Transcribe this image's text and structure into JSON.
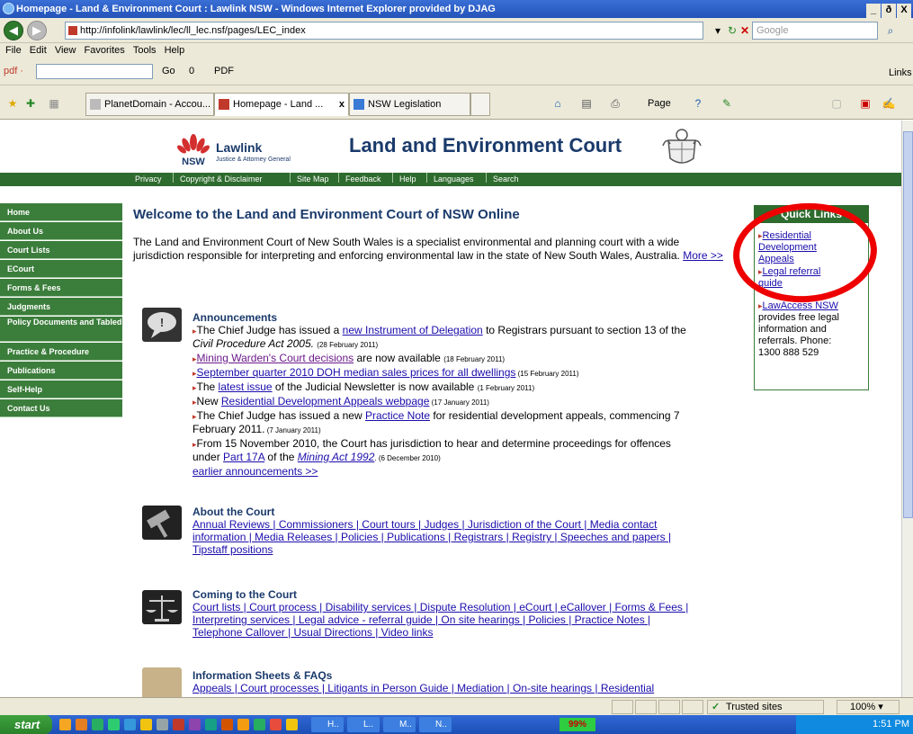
{
  "window": {
    "title": "Homepage - Land & Environment Court : Lawlink NSW - Windows Internet Explorer provided by DJAG",
    "btn_min": "_",
    "btn_max": "ð",
    "btn_close": "X"
  },
  "address": {
    "url": "http://infolink/lawlink/lec/ll_lec.nsf/pages/LEC_index",
    "search_placeholder": "Google"
  },
  "menu": [
    "File",
    "Edit",
    "View",
    "Favorites",
    "Tools",
    "Help"
  ],
  "linksbar": {
    "pdf_label": "pdf ·",
    "go_label": "Go",
    "zero_label": "0",
    "pdf_btn": "PDF",
    "links_label": "Links"
  },
  "tabs": [
    {
      "label": "PlanetDomain - Accou..."
    },
    {
      "label": "Homepage - Land ...",
      "close": "x"
    },
    {
      "label": "NSW Legislation"
    }
  ],
  "toolbar_right": {
    "page_label": "Page",
    "tools_label": "▾"
  },
  "site": {
    "nsw_label": "NSW",
    "lawlink": "Lawlink",
    "lawlink_sub": "Justice & Attorney General",
    "title": "Land and Environment Court"
  },
  "topnav": [
    "Privacy",
    "Copyright & Disclaimer",
    "Site Map",
    "Feedback",
    "Help",
    "Languages",
    "Search"
  ],
  "sidebar": [
    {
      "label": "Home"
    },
    {
      "label": "About Us"
    },
    {
      "label": "Court Lists"
    },
    {
      "label": "ECourt"
    },
    {
      "label": "Forms & Fees"
    },
    {
      "label": "Judgments"
    },
    {
      "label": "Policy Documents and Tabled Documents"
    },
    {
      "label": "Practice & Procedure"
    },
    {
      "label": "Publications"
    },
    {
      "label": "Self-Help"
    },
    {
      "label": "Contact Us"
    }
  ],
  "main": {
    "heading": "Welcome to the Land and Environment Court of NSW Online",
    "intro": "The Land and Environment Court of New South Wales is a specialist environmental and planning court with a wide jurisdiction responsible for interpreting and enforcing environmental law in the state of New South Wales, Australia.",
    "more": "More >>"
  },
  "quicklinks": {
    "title": "Quick Links",
    "items": [
      "Residential Development Appeals",
      "Legal referral guide",
      "LawAccess NSW"
    ],
    "lawaccess_text": "provides free legal information and referrals. Phone: 1300 888 529",
    "phone_line1": "provides free legal",
    "phone_line2": "information and",
    "phone_line3": "referrals. Phone:",
    "phone_line4": "1300 888 529",
    "rda_1": "Residential",
    "rda_2": "Development",
    "rda_3": "Appeals",
    "lrg_1": "Legal referral",
    "lrg_2": "guide"
  },
  "announcements": {
    "title": "Announcements",
    "a1_pre": "The Chief Judge has issued a ",
    "a1_link": "new Instrument of Delegation",
    "a1_post": " to Registrars pursuant to section 13 of the",
    "a1_cont": "Civil Procedure Act 2005.",
    "a1_date": "(28 February 2011)",
    "a2_link": "Mining Warden's Court decisions",
    "a2_post": " are now available ",
    "a2_date": "(18 February 2011)",
    "a3_link": "September quarter 2010 DOH median sales prices for all dwellings",
    "a3_date": " (15 February 2011)",
    "a4_pre": "The ",
    "a4_link": "latest issue",
    "a4_post": " of the Judicial Newsletter is now available ",
    "a4_date": "(1 February 2011)",
    "a5_pre": "New ",
    "a5_link": "Residential Development Appeals webpage",
    "a5_date": " (17 January 2011)",
    "a6_pre": "The Chief Judge has issued a new ",
    "a6_link": "Practice Note",
    "a6_post": " for residential development appeals, commencing 7",
    "a6_cont": "February 2011.",
    "a6_date": " (7 January 2011)",
    "a7_pre": "From 15 November 2010, the Court has jurisdiction to hear and determine proceedings for offences",
    "a7_cont_pre": "under ",
    "a7_link1": "Part 17A",
    "a7_mid": " of the ",
    "a7_link2": "Mining Act 1992",
    "a7_date": ". (6 December 2010)",
    "earlier": "earlier announcements >>"
  },
  "about": {
    "title": "About the Court",
    "line1": "Annual Reviews | Commissioners | Court tours | Judges | Jurisdiction of the Court | Media contact",
    "line2": "information | Media Releases | Policies | Publications | Registrars | Registry | Speeches and papers |",
    "line3": "Tipstaff positions"
  },
  "coming": {
    "title": "Coming to the Court",
    "line1": "Court lists | Court process | Disability services | Dispute Resolution | eCourt | eCallover | Forms & Fees |",
    "line2": "Interpreting services | Legal advice - referral guide | On site hearings | Policies | Practice Notes |",
    "line3": "Telephone Callover | Usual Directions | Video links"
  },
  "info": {
    "title": "Information Sheets & FAQs",
    "line1": "Appeals | Court processes | Litigants in Person Guide | Mediation | On-site hearings | Residential"
  },
  "status": {
    "zone": "Trusted sites",
    "zoom": "100%"
  },
  "taskbar": {
    "start": "start",
    "clock": "1:51 PM",
    "tasks": [
      "H..",
      "L..",
      "M..",
      "N.."
    ],
    "pct": "99%"
  },
  "colors": {
    "green": "#3b7d3b",
    "navy": "#1a3a6b",
    "highlight": "#e00000"
  }
}
